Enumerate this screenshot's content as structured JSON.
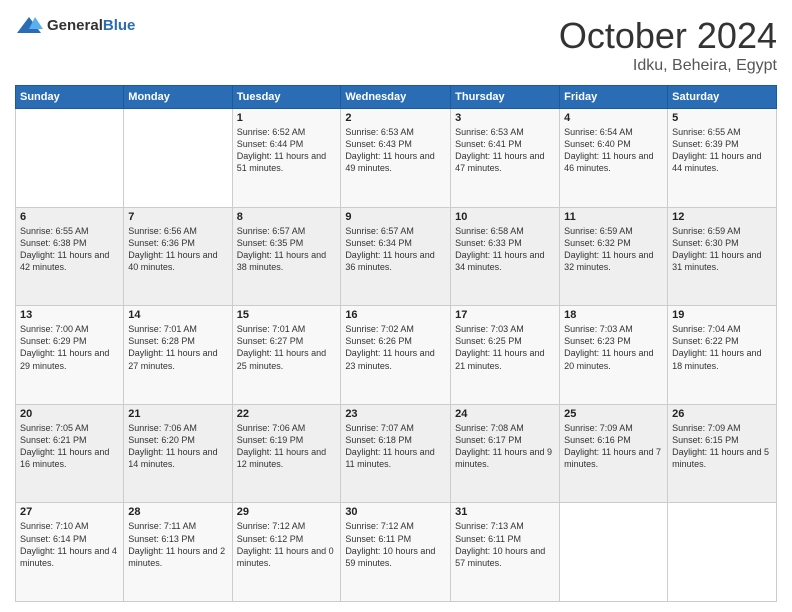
{
  "header": {
    "logo_general": "General",
    "logo_blue": "Blue",
    "month": "October 2024",
    "location": "Idku, Beheira, Egypt"
  },
  "weekdays": [
    "Sunday",
    "Monday",
    "Tuesday",
    "Wednesday",
    "Thursday",
    "Friday",
    "Saturday"
  ],
  "weeks": [
    [
      {
        "day": "",
        "sunrise": "",
        "sunset": "",
        "daylight": ""
      },
      {
        "day": "",
        "sunrise": "",
        "sunset": "",
        "daylight": ""
      },
      {
        "day": "1",
        "sunrise": "Sunrise: 6:52 AM",
        "sunset": "Sunset: 6:44 PM",
        "daylight": "Daylight: 11 hours and 51 minutes."
      },
      {
        "day": "2",
        "sunrise": "Sunrise: 6:53 AM",
        "sunset": "Sunset: 6:43 PM",
        "daylight": "Daylight: 11 hours and 49 minutes."
      },
      {
        "day": "3",
        "sunrise": "Sunrise: 6:53 AM",
        "sunset": "Sunset: 6:41 PM",
        "daylight": "Daylight: 11 hours and 47 minutes."
      },
      {
        "day": "4",
        "sunrise": "Sunrise: 6:54 AM",
        "sunset": "Sunset: 6:40 PM",
        "daylight": "Daylight: 11 hours and 46 minutes."
      },
      {
        "day": "5",
        "sunrise": "Sunrise: 6:55 AM",
        "sunset": "Sunset: 6:39 PM",
        "daylight": "Daylight: 11 hours and 44 minutes."
      }
    ],
    [
      {
        "day": "6",
        "sunrise": "Sunrise: 6:55 AM",
        "sunset": "Sunset: 6:38 PM",
        "daylight": "Daylight: 11 hours and 42 minutes."
      },
      {
        "day": "7",
        "sunrise": "Sunrise: 6:56 AM",
        "sunset": "Sunset: 6:36 PM",
        "daylight": "Daylight: 11 hours and 40 minutes."
      },
      {
        "day": "8",
        "sunrise": "Sunrise: 6:57 AM",
        "sunset": "Sunset: 6:35 PM",
        "daylight": "Daylight: 11 hours and 38 minutes."
      },
      {
        "day": "9",
        "sunrise": "Sunrise: 6:57 AM",
        "sunset": "Sunset: 6:34 PM",
        "daylight": "Daylight: 11 hours and 36 minutes."
      },
      {
        "day": "10",
        "sunrise": "Sunrise: 6:58 AM",
        "sunset": "Sunset: 6:33 PM",
        "daylight": "Daylight: 11 hours and 34 minutes."
      },
      {
        "day": "11",
        "sunrise": "Sunrise: 6:59 AM",
        "sunset": "Sunset: 6:32 PM",
        "daylight": "Daylight: 11 hours and 32 minutes."
      },
      {
        "day": "12",
        "sunrise": "Sunrise: 6:59 AM",
        "sunset": "Sunset: 6:30 PM",
        "daylight": "Daylight: 11 hours and 31 minutes."
      }
    ],
    [
      {
        "day": "13",
        "sunrise": "Sunrise: 7:00 AM",
        "sunset": "Sunset: 6:29 PM",
        "daylight": "Daylight: 11 hours and 29 minutes."
      },
      {
        "day": "14",
        "sunrise": "Sunrise: 7:01 AM",
        "sunset": "Sunset: 6:28 PM",
        "daylight": "Daylight: 11 hours and 27 minutes."
      },
      {
        "day": "15",
        "sunrise": "Sunrise: 7:01 AM",
        "sunset": "Sunset: 6:27 PM",
        "daylight": "Daylight: 11 hours and 25 minutes."
      },
      {
        "day": "16",
        "sunrise": "Sunrise: 7:02 AM",
        "sunset": "Sunset: 6:26 PM",
        "daylight": "Daylight: 11 hours and 23 minutes."
      },
      {
        "day": "17",
        "sunrise": "Sunrise: 7:03 AM",
        "sunset": "Sunset: 6:25 PM",
        "daylight": "Daylight: 11 hours and 21 minutes."
      },
      {
        "day": "18",
        "sunrise": "Sunrise: 7:03 AM",
        "sunset": "Sunset: 6:23 PM",
        "daylight": "Daylight: 11 hours and 20 minutes."
      },
      {
        "day": "19",
        "sunrise": "Sunrise: 7:04 AM",
        "sunset": "Sunset: 6:22 PM",
        "daylight": "Daylight: 11 hours and 18 minutes."
      }
    ],
    [
      {
        "day": "20",
        "sunrise": "Sunrise: 7:05 AM",
        "sunset": "Sunset: 6:21 PM",
        "daylight": "Daylight: 11 hours and 16 minutes."
      },
      {
        "day": "21",
        "sunrise": "Sunrise: 7:06 AM",
        "sunset": "Sunset: 6:20 PM",
        "daylight": "Daylight: 11 hours and 14 minutes."
      },
      {
        "day": "22",
        "sunrise": "Sunrise: 7:06 AM",
        "sunset": "Sunset: 6:19 PM",
        "daylight": "Daylight: 11 hours and 12 minutes."
      },
      {
        "day": "23",
        "sunrise": "Sunrise: 7:07 AM",
        "sunset": "Sunset: 6:18 PM",
        "daylight": "Daylight: 11 hours and 11 minutes."
      },
      {
        "day": "24",
        "sunrise": "Sunrise: 7:08 AM",
        "sunset": "Sunset: 6:17 PM",
        "daylight": "Daylight: 11 hours and 9 minutes."
      },
      {
        "day": "25",
        "sunrise": "Sunrise: 7:09 AM",
        "sunset": "Sunset: 6:16 PM",
        "daylight": "Daylight: 11 hours and 7 minutes."
      },
      {
        "day": "26",
        "sunrise": "Sunrise: 7:09 AM",
        "sunset": "Sunset: 6:15 PM",
        "daylight": "Daylight: 11 hours and 5 minutes."
      }
    ],
    [
      {
        "day": "27",
        "sunrise": "Sunrise: 7:10 AM",
        "sunset": "Sunset: 6:14 PM",
        "daylight": "Daylight: 11 hours and 4 minutes."
      },
      {
        "day": "28",
        "sunrise": "Sunrise: 7:11 AM",
        "sunset": "Sunset: 6:13 PM",
        "daylight": "Daylight: 11 hours and 2 minutes."
      },
      {
        "day": "29",
        "sunrise": "Sunrise: 7:12 AM",
        "sunset": "Sunset: 6:12 PM",
        "daylight": "Daylight: 11 hours and 0 minutes."
      },
      {
        "day": "30",
        "sunrise": "Sunrise: 7:12 AM",
        "sunset": "Sunset: 6:11 PM",
        "daylight": "Daylight: 10 hours and 59 minutes."
      },
      {
        "day": "31",
        "sunrise": "Sunrise: 7:13 AM",
        "sunset": "Sunset: 6:11 PM",
        "daylight": "Daylight: 10 hours and 57 minutes."
      },
      {
        "day": "",
        "sunrise": "",
        "sunset": "",
        "daylight": ""
      },
      {
        "day": "",
        "sunrise": "",
        "sunset": "",
        "daylight": ""
      }
    ]
  ]
}
